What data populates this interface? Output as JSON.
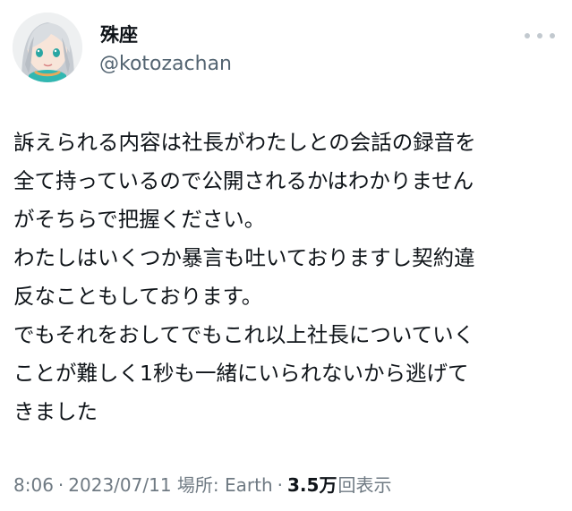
{
  "author": {
    "display_name": "殊座",
    "handle": "@kotozachan",
    "avatar_icon": "avatar-icon"
  },
  "tweet": {
    "lines": [
      "訴えられる内容は社長がわたしとの会話の録音を",
      "全て持っているので公開されるかはわかりません",
      "がそちらで把握ください。",
      "わたしはいくつか暴言も吐いておりますし契約違",
      "反なこともしております。",
      "でもそれをおしてでもこれ以上社長についていく",
      "ことが難しく1秒も一緒にいられないから逃げて",
      "きました"
    ]
  },
  "meta": {
    "time": "8:06",
    "date": "2023/07/11",
    "location_label": "場所: Earth",
    "separator": "·",
    "view_count": "3.5万",
    "view_label": "回表示"
  },
  "icons": {
    "more": "more-icon"
  },
  "colors": {
    "text": "#0f1419",
    "secondary_text": "#536471",
    "background": "#ffffff"
  }
}
